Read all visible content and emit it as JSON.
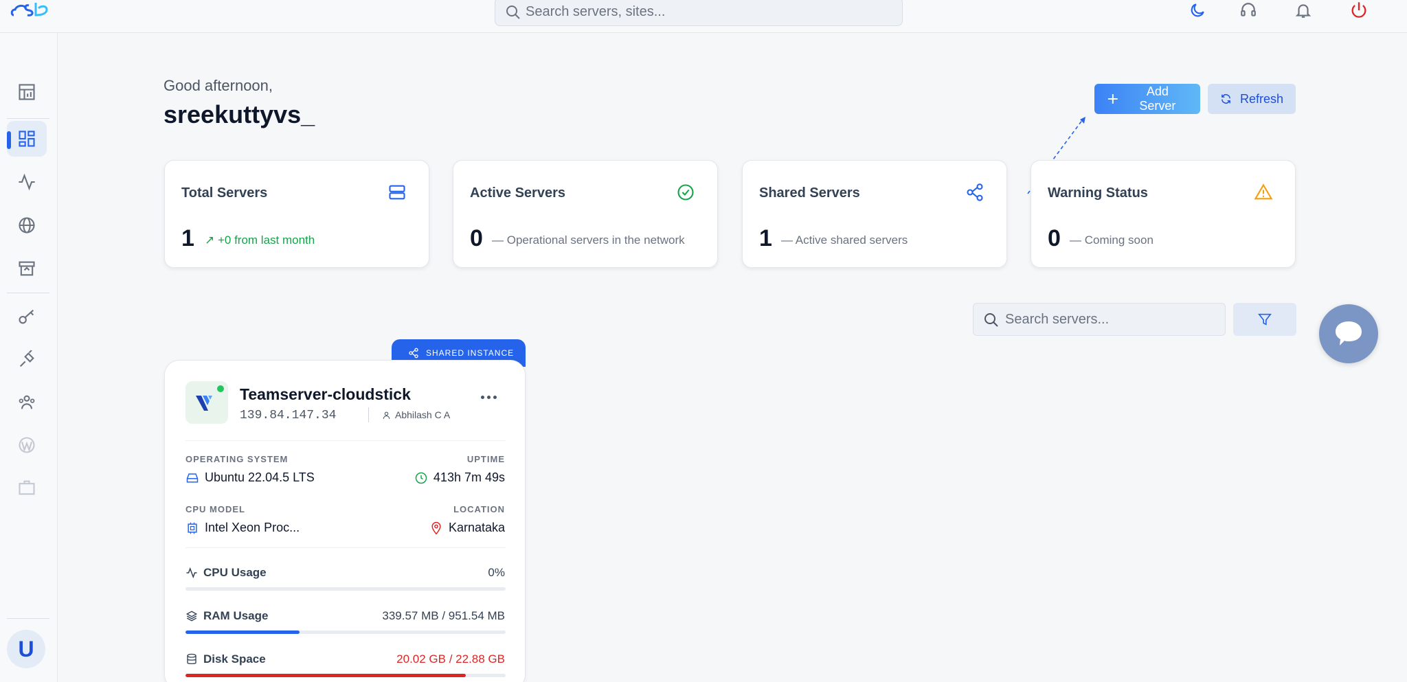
{
  "header": {
    "search_placeholder": "Search servers, sites...",
    "icons": [
      "moon-icon",
      "headset-icon",
      "bell-icon",
      "power-icon"
    ]
  },
  "greeting": {
    "salutation": "Good afternoon,",
    "username": "sreekuttyvs_"
  },
  "actions": {
    "add_server_label": "Add Server",
    "refresh_label": "Refresh"
  },
  "stats": [
    {
      "title": "Total Servers",
      "value": "1",
      "sub": "+0 from last month",
      "icon": "server-icon",
      "color": "#2563eb"
    },
    {
      "title": "Active Servers",
      "value": "0",
      "sub": "Operational servers in the network",
      "icon": "check-circle-icon",
      "color": "#16a34a"
    },
    {
      "title": "Shared Servers",
      "value": "1",
      "sub": "Active shared servers",
      "icon": "share-icon",
      "color": "#2563eb"
    },
    {
      "title": "Warning Status",
      "value": "0",
      "sub": "Coming soon",
      "icon": "warning-icon",
      "color": "#f59e0b"
    }
  ],
  "server_search": {
    "placeholder": "Search servers..."
  },
  "server": {
    "tag": "SHARED INSTANCE",
    "name": "Teamserver-cloudstick",
    "ip": "139.84.147.34",
    "owner": "Abhilash C A",
    "os_label": "OPERATING SYSTEM",
    "os": "Ubuntu 22.04.5 LTS",
    "uptime_label": "UPTIME",
    "uptime": "413h 7m 49s",
    "cpu_model_label": "CPU MODEL",
    "cpu_model": "Intel Xeon Proc...",
    "location_label": "LOCATION",
    "location": "Karnataka",
    "metrics": {
      "cpu": {
        "label": "CPU Usage",
        "value": "0%",
        "fraction": 0
      },
      "ram": {
        "label": "RAM Usage",
        "value": "339.57 MB / 951.54 MB",
        "fraction": 0.357
      },
      "disk": {
        "label": "Disk Space",
        "value": "20.02 GB / 22.88 GB",
        "fraction": 0.875
      }
    }
  },
  "colors": {
    "accent": "#2563eb",
    "danger": "#dc2626",
    "success": "#22c55e"
  },
  "user": {
    "avatar_letter": "U"
  }
}
